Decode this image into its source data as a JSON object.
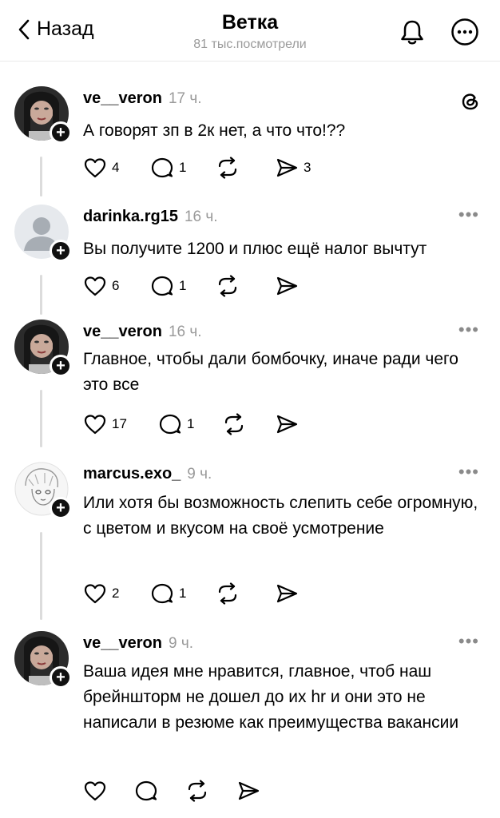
{
  "header": {
    "back_label": "Назад",
    "title": "Ветка",
    "subtitle": "81 тыс.посмотрели"
  },
  "posts": [
    {
      "username": "ve__veron",
      "time": "17 ч.",
      "text": "А говорят зп в 2к нет, а что что!??",
      "likes": "4",
      "replies": "1",
      "shares": "3",
      "corner": "threads-logo"
    },
    {
      "username": "darinka.rg15",
      "time": "16 ч.",
      "text": "Вы получите 1200 и плюс ещё налог вычтут",
      "likes": "6",
      "replies": "1",
      "shares": "",
      "corner": "more"
    },
    {
      "username": "ve__veron",
      "time": "16 ч.",
      "text": "Главное, чтобы дали бомбочку, иначе ради чего это все",
      "likes": "17",
      "replies": "1",
      "shares": "",
      "corner": "more"
    },
    {
      "username": "marcus.exo_",
      "time": "9 ч.",
      "text": "Или хотя бы возможность слепить себе огромную, с цветом и вкусом на своё усмотрение",
      "likes": "2",
      "replies": "1",
      "shares": "",
      "corner": "more"
    },
    {
      "username": "ve__veron",
      "time": "9 ч.",
      "text": "Ваша идея мне нравится, главное, чтоб наш брейншторм не дошел до их hr и они это не написали в резюме как преимущества вакансии",
      "likes": "",
      "replies": "",
      "shares": "",
      "corner": "more"
    }
  ],
  "icons": {
    "back": "chevron-left-icon",
    "bell": "bell-icon",
    "more": "more-circle-icon",
    "like": "heart-icon",
    "reply": "comment-icon",
    "repost": "repost-icon",
    "share": "send-icon",
    "follow": "plus-icon"
  },
  "dots_label": "•••",
  "colors": {
    "text": "#000000",
    "muted": "#9a9a9a",
    "line": "#dcdcdc",
    "badge": "#111111"
  }
}
